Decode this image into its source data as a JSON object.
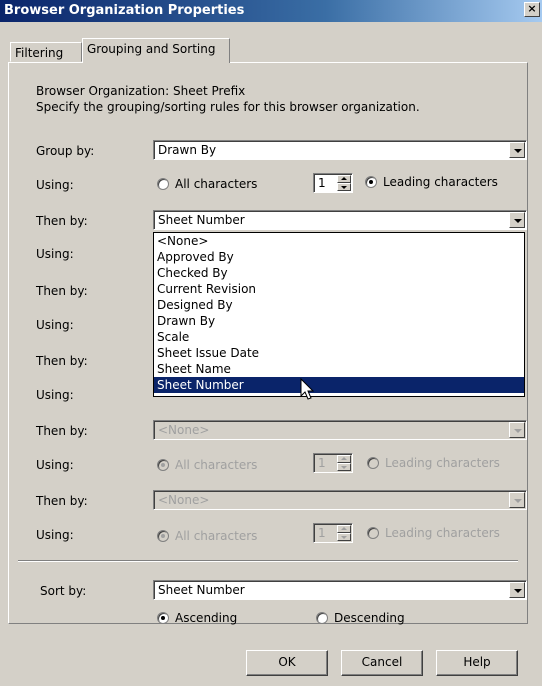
{
  "window": {
    "title": "Browser Organization Properties",
    "close_glyph": "×"
  },
  "tabs": [
    {
      "label": "Filtering",
      "active": false
    },
    {
      "label": "Grouping and Sorting",
      "active": true
    }
  ],
  "header": {
    "line1": "Browser Organization: Sheet Prefix",
    "line2": "Specify the grouping/sorting rules for this browser organization."
  },
  "rows": {
    "group_by": {
      "label": "Group by:",
      "value": "Drawn By"
    },
    "using1": {
      "label": "Using:",
      "all": "All characters",
      "count": "1",
      "leading": "Leading characters",
      "selected": "leading"
    },
    "then1": {
      "label": "Then by:",
      "value": "Sheet Number"
    },
    "using2": {
      "label": "Using:"
    },
    "then2": {
      "label": "Then by:"
    },
    "using3": {
      "label": "Using:"
    },
    "then3": {
      "label": "Then by:"
    },
    "using4": {
      "label": "Using:"
    },
    "then4": {
      "label": "Then by:",
      "value": "<None>"
    },
    "using5": {
      "label": "Using:",
      "all": "All characters",
      "count": "1",
      "leading": "Leading characters"
    },
    "then5": {
      "label": "Then by:",
      "value": "<None>"
    },
    "using6": {
      "label": "Using:",
      "all": "All characters",
      "count": "1",
      "leading": "Leading characters"
    }
  },
  "dropdown": {
    "options": [
      "<None>",
      "Approved By",
      "Checked By",
      "Current Revision",
      "Designed By",
      "Drawn By",
      "Scale",
      "Sheet Issue Date",
      "Sheet Name",
      "Sheet Number"
    ],
    "selected": "Sheet Number"
  },
  "sort": {
    "label": "Sort by:",
    "value": "Sheet Number",
    "ascending": "Ascending",
    "descending": "Descending",
    "selected": "ascending"
  },
  "buttons": {
    "ok": "OK",
    "cancel": "Cancel",
    "help": "Help"
  },
  "colors": {
    "title_bar": "#0a246a",
    "dialog_bg": "#d4d0c8",
    "highlight": "#0a246a"
  }
}
